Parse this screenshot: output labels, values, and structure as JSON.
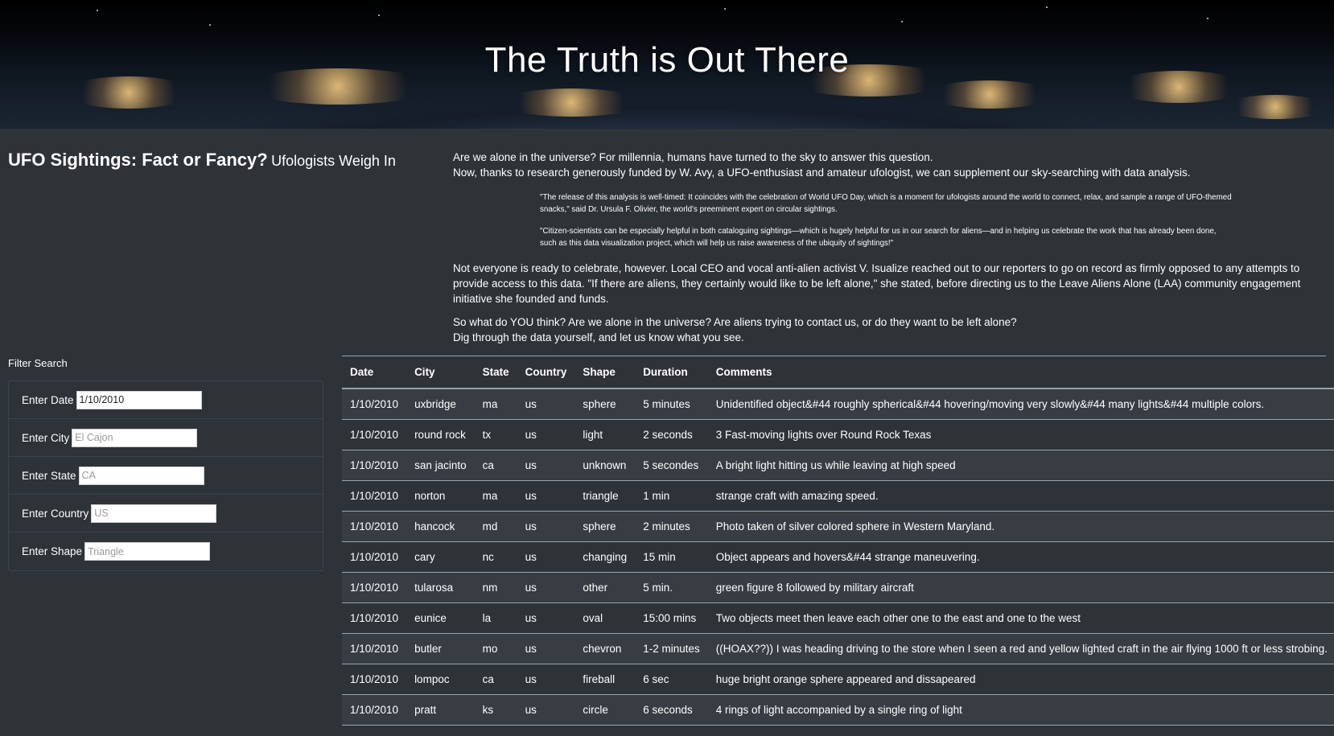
{
  "hero": {
    "title": "The Truth is Out There"
  },
  "heading": {
    "main": "UFO Sightings: Fact or Fancy?",
    "sub": "Ufologists Weigh In"
  },
  "intro": {
    "line1": "Are we alone in the universe? For millennia, humans have turned to the sky to answer this question.",
    "line2": "Now, thanks to research generously funded by W. Avy, a UFO-enthusiast and amateur ufologist, we can supplement our sky-searching with data analysis.",
    "quote1": "\"The release of this analysis is well-timed: It coincides with the celebration of World UFO Day, which is a moment for ufologists around the world to connect, relax, and sample a range of UFO-themed snacks,\" said Dr. Ursula F. Olivier, the world's preeminent expert on circular sightings.",
    "quote2": "\"Citizen-scientists can be especially helpful in both cataloguing sightings—which is hugely helpful for us in our search for aliens—and in helping us celebrate the work that has already been done, such as this data visualization project, which will help us raise awareness of the ubiquity of sightings!\"",
    "para3": "Not everyone is ready to celebrate, however. Local CEO and vocal anti-alien activist V. Isualize reached out to our reporters to go on record as firmly opposed to any attempts to provide access to this data. \"If there are aliens, they certainly would like to be left alone,\" she stated, before directing us to the Leave Aliens Alone (LAA) community engagement initiative she founded and funds.",
    "para4a": "So what do YOU think? Are we alone in the universe? Are aliens trying to contact us, or do they want to be left alone?",
    "para4b": "Dig through the data yourself, and let us know what you see."
  },
  "filters": {
    "title": "Filter Search",
    "date": {
      "label": "Enter Date",
      "value": "1/10/2010",
      "placeholder": ""
    },
    "city": {
      "label": "Enter City",
      "value": "",
      "placeholder": "El Cajon"
    },
    "state": {
      "label": "Enter State",
      "value": "",
      "placeholder": "CA"
    },
    "country": {
      "label": "Enter Country",
      "value": "",
      "placeholder": "US"
    },
    "shape": {
      "label": "Enter Shape",
      "value": "",
      "placeholder": "Triangle"
    }
  },
  "table": {
    "headers": [
      "Date",
      "City",
      "State",
      "Country",
      "Shape",
      "Duration",
      "Comments"
    ],
    "rows": [
      [
        "1/10/2010",
        "uxbridge",
        "ma",
        "us",
        "sphere",
        "5 minutes",
        "Unidentified object&#44 roughly spherical&#44 hovering/moving very slowly&#44 many lights&#44 multiple colors."
      ],
      [
        "1/10/2010",
        "round rock",
        "tx",
        "us",
        "light",
        "2 seconds",
        "3 Fast-moving lights over Round Rock Texas"
      ],
      [
        "1/10/2010",
        "san jacinto",
        "ca",
        "us",
        "unknown",
        "5 secondes",
        "A bright light hitting us while leaving at high speed"
      ],
      [
        "1/10/2010",
        "norton",
        "ma",
        "us",
        "triangle",
        "1 min",
        "strange craft with amazing speed."
      ],
      [
        "1/10/2010",
        "hancock",
        "md",
        "us",
        "sphere",
        "2 minutes",
        "Photo taken of silver colored sphere in Western Maryland."
      ],
      [
        "1/10/2010",
        "cary",
        "nc",
        "us",
        "changing",
        "15 min",
        "Object appears and hovers&#44 strange maneuvering."
      ],
      [
        "1/10/2010",
        "tularosa",
        "nm",
        "us",
        "other",
        "5 min.",
        "green figure 8 followed by military aircraft"
      ],
      [
        "1/10/2010",
        "eunice",
        "la",
        "us",
        "oval",
        "15:00 mins",
        "Two objects meet then leave each other one to the east and one to the west"
      ],
      [
        "1/10/2010",
        "butler",
        "mo",
        "us",
        "chevron",
        "1-2 minutes",
        "((HOAX??)) I was heading driving to the store when I seen a red and yellow lighted craft in the air flying 1000 ft or less strobing."
      ],
      [
        "1/10/2010",
        "lompoc",
        "ca",
        "us",
        "fireball",
        "6 sec",
        "huge bright orange sphere appeared and dissapeared"
      ],
      [
        "1/10/2010",
        "pratt",
        "ks",
        "us",
        "circle",
        "6 seconds",
        "4 rings of light accompanied by a single ring of light"
      ]
    ]
  }
}
